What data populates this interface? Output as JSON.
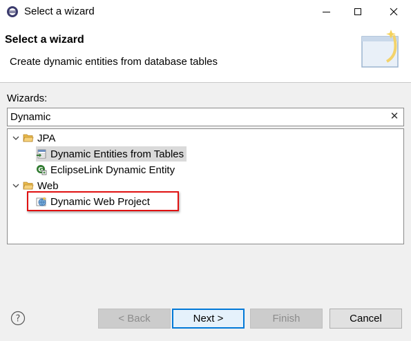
{
  "window": {
    "title": "Select a wizard",
    "controls": {
      "minimize": "minimize",
      "maximize": "maximize",
      "close": "close"
    }
  },
  "banner": {
    "title": "Select a wizard",
    "description": "Create dynamic entities from database tables"
  },
  "filter": {
    "label": "Wizards:",
    "value": "Dynamic",
    "clear_glyph": "✕"
  },
  "tree": {
    "items": [
      {
        "label": "JPA",
        "type": "folder",
        "expanded": true
      },
      {
        "label": "Dynamic Entities from Tables",
        "type": "wizard",
        "selected": true
      },
      {
        "label": "EclipseLink Dynamic Entity",
        "type": "wizard"
      },
      {
        "label": "Web",
        "type": "folder",
        "expanded": true
      },
      {
        "label": "Dynamic Web Project",
        "type": "wizard",
        "highlighted": true
      }
    ]
  },
  "buttons": {
    "help": "?",
    "back": "< Back",
    "next": "Next >",
    "finish": "Finish",
    "cancel": "Cancel"
  },
  "colors": {
    "highlight_border": "#e01010",
    "default_button_border": "#0078d7",
    "selection": "#dadada",
    "folder": "#e8b94a"
  }
}
